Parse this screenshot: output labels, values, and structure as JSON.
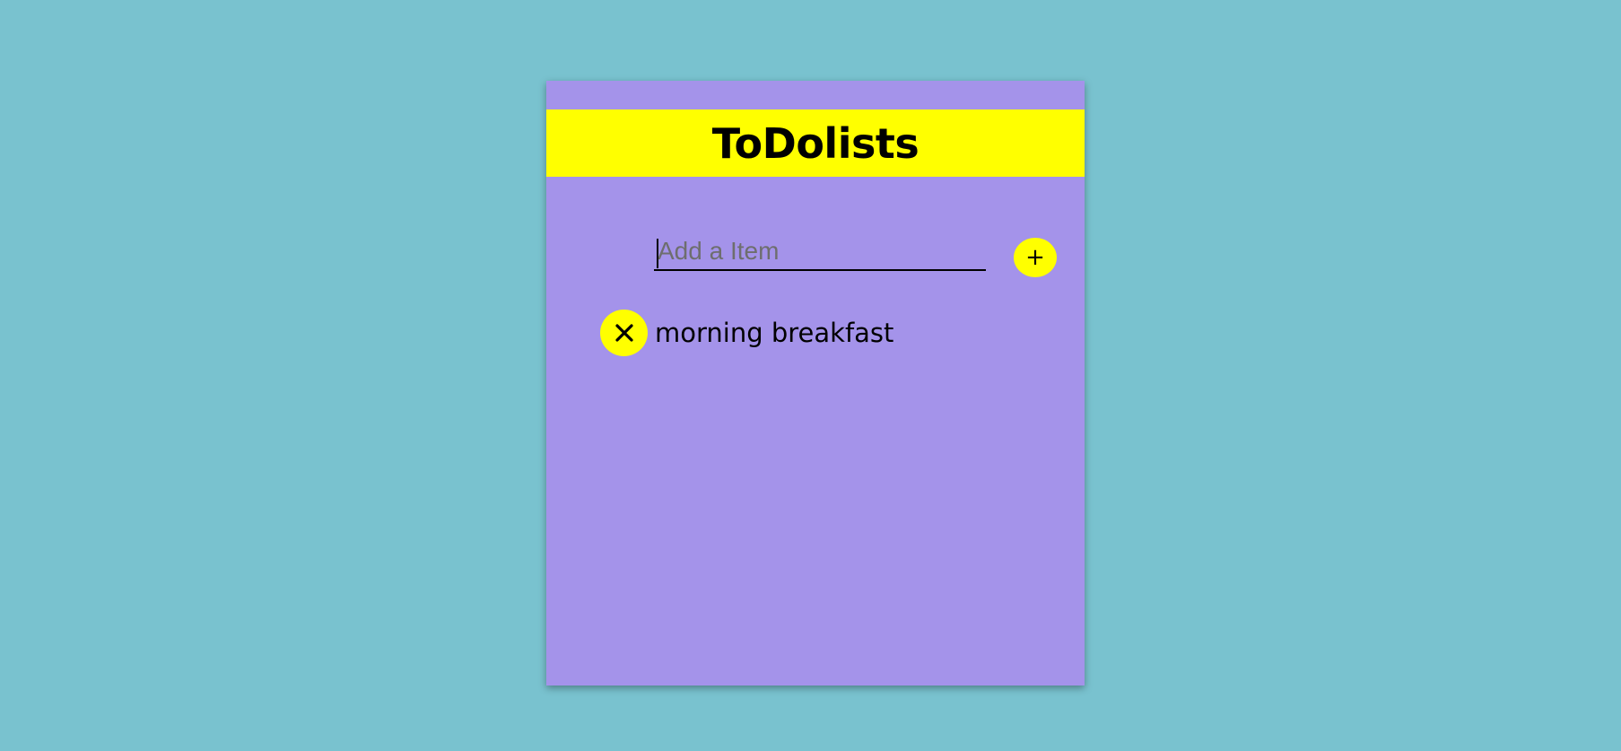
{
  "app": {
    "title": "ToDolists"
  },
  "input": {
    "placeholder": "Add a Item",
    "value": ""
  },
  "add_button": {
    "label": "+",
    "icon": "plus-icon"
  },
  "items": [
    {
      "text": "morning breakfast",
      "delete_icon": "close-icon"
    }
  ],
  "colors": {
    "background": "#79c2cf",
    "card": "#a493ea",
    "accent": "#ffff00",
    "text": "#000000"
  }
}
